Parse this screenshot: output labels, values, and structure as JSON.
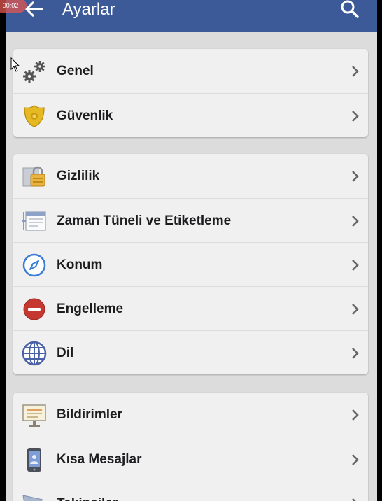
{
  "recording": {
    "timer": "00:02"
  },
  "appbar": {
    "title": "Ayarlar",
    "back_icon": "arrow-left-icon",
    "search_icon": "search-icon"
  },
  "groups": [
    {
      "items": [
        {
          "label": "Genel",
          "icon": "gears-icon"
        },
        {
          "label": "Güvenlik",
          "icon": "security-badge-icon"
        }
      ]
    },
    {
      "items": [
        {
          "label": "Gizlilik",
          "icon": "privacy-lock-icon"
        },
        {
          "label": "Zaman Tüneli ve Etiketleme",
          "icon": "timeline-icon"
        },
        {
          "label": "Konum",
          "icon": "compass-icon"
        },
        {
          "label": "Engelleme",
          "icon": "block-icon"
        },
        {
          "label": "Dil",
          "icon": "globe-icon"
        }
      ]
    },
    {
      "items": [
        {
          "label": "Bildirimler",
          "icon": "notification-board-icon"
        },
        {
          "label": "Kısa Mesajlar",
          "icon": "phone-sms-icon"
        },
        {
          "label": "Takipçiler",
          "icon": "followers-icon"
        }
      ]
    }
  ],
  "colors": {
    "appbar": "#3d5a98",
    "background": "#dcdcdc",
    "card": "#f1f0f0"
  }
}
